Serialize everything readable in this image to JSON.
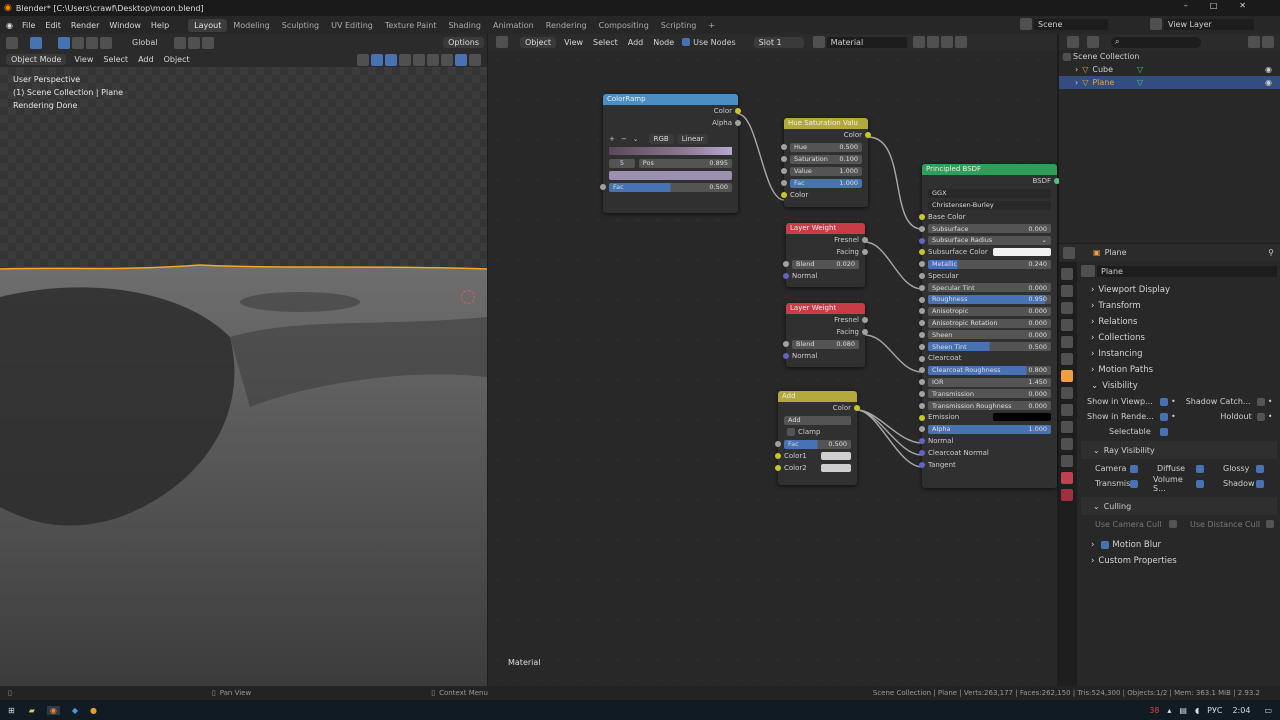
{
  "window": {
    "title": "Blender* [C:\\Users\\crawf\\Desktop\\moon.blend]"
  },
  "menubar": {
    "menus": [
      "File",
      "Edit",
      "Render",
      "Window",
      "Help"
    ],
    "workspaces": [
      "Layout",
      "Modeling",
      "Sculpting",
      "UV Editing",
      "Texture Paint",
      "Shading",
      "Animation",
      "Rendering",
      "Compositing",
      "Scripting"
    ],
    "add_tab": "+",
    "scene": "Scene",
    "view_layer": "View Layer"
  },
  "viewport_header": {
    "orientation": "Global",
    "options": "Options",
    "mode": "Object Mode",
    "menus": [
      "View",
      "Select",
      "Add",
      "Object"
    ]
  },
  "viewport": {
    "info_line1": "User Perspective",
    "info_line2": "(1) Scene Collection | Plane",
    "info_line3": "Rendering Done"
  },
  "node_header": {
    "object_type": "Object",
    "menus": [
      "View",
      "Select",
      "Add",
      "Node"
    ],
    "use_nodes_label": "Use Nodes",
    "slot": "Slot 1",
    "material": "Material",
    "footer_label": "Material"
  },
  "nodes": {
    "colorramp": {
      "title": "ColorRamp",
      "out_color": "Color",
      "out_alpha": "Alpha",
      "mode": "RGB",
      "interp": "Linear",
      "stop_index": "5",
      "pos_label": "Pos",
      "pos_value": "0.895",
      "fac_label": "Fac",
      "fac_value": "0.500",
      "fac_fraction": 0.5
    },
    "hsv": {
      "title": "Hue Saturation Valu",
      "out_color": "Color",
      "hue_label": "Hue",
      "hue_value": "0.500",
      "sat_label": "Saturation",
      "sat_value": "0.100",
      "val_label": "Value",
      "val_value": "1.000",
      "fac_label": "Fac",
      "fac_value": "1.000",
      "fac_fraction": 1.0,
      "in_color": "Color"
    },
    "layerweight1": {
      "title": "Layer Weight",
      "out_fresnel": "Fresnel",
      "out_facing": "Facing",
      "blend_label": "Blend",
      "blend_value": "0.020",
      "in_normal": "Normal"
    },
    "layerweight2": {
      "title": "Layer Weight",
      "out_fresnel": "Fresnel",
      "out_facing": "Facing",
      "blend_label": "Blend",
      "blend_value": "0.080",
      "in_normal": "Normal"
    },
    "add": {
      "title": "Add",
      "out_color": "Color",
      "blend_mode": "Add",
      "clamp_label": "Clamp",
      "fac_label": "Fac",
      "fac_value": "0.500",
      "fac_fraction": 0.5,
      "color1_label": "Color1",
      "color2_label": "Color2"
    },
    "bsdf": {
      "title": "Principled BSDF",
      "out_label": "BSDF",
      "distribution": "GGX",
      "subsurface_method": "Christensen-Burley",
      "rows": [
        {
          "label": "Base Color",
          "value": "",
          "type": "socket"
        },
        {
          "label": "Subsurface",
          "value": "0.000",
          "type": "field",
          "fill": 0
        },
        {
          "label": "Subsurface Radius",
          "value": "",
          "type": "dropdown"
        },
        {
          "label": "Subsurface Color",
          "value": "",
          "type": "color"
        },
        {
          "label": "Metallic",
          "value": "0.240",
          "type": "field",
          "fill": 0.24
        },
        {
          "label": "Specular",
          "value": "",
          "type": "socket"
        },
        {
          "label": "Specular Tint",
          "value": "0.000",
          "type": "field",
          "fill": 0
        },
        {
          "label": "Roughness",
          "value": "0.950",
          "type": "field",
          "fill": 0.95
        },
        {
          "label": "Anisotropic",
          "value": "0.000",
          "type": "field",
          "fill": 0
        },
        {
          "label": "Anisotropic Rotation",
          "value": "0.000",
          "type": "field",
          "fill": 0
        },
        {
          "label": "Sheen",
          "value": "0.000",
          "type": "field",
          "fill": 0
        },
        {
          "label": "Sheen Tint",
          "value": "0.500",
          "type": "field",
          "fill": 0.5
        },
        {
          "label": "Clearcoat",
          "value": "",
          "type": "socket"
        },
        {
          "label": "Clearcoat Roughness",
          "value": "0.800",
          "type": "field",
          "fill": 0.8
        },
        {
          "label": "IOR",
          "value": "1.450",
          "type": "field",
          "fill": 0
        },
        {
          "label": "Transmission",
          "value": "0.000",
          "type": "field",
          "fill": 0
        },
        {
          "label": "Transmission Roughness",
          "value": "0.000",
          "type": "field",
          "fill": 0
        },
        {
          "label": "Emission",
          "value": "",
          "type": "blackcolor"
        },
        {
          "label": "Alpha",
          "value": "1.000",
          "type": "field",
          "fill": 1
        },
        {
          "label": "Normal",
          "value": "",
          "type": "socket"
        },
        {
          "label": "Clearcoat Normal",
          "value": "",
          "type": "socket"
        },
        {
          "label": "Tangent",
          "value": "",
          "type": "socket"
        }
      ]
    }
  },
  "outliner": {
    "root": "Scene Collection",
    "items": [
      "Cube",
      "Plane"
    ]
  },
  "properties": {
    "object_name": "Plane",
    "data_name": "Plane",
    "sections": [
      "Viewport Display",
      "Transform",
      "Relations",
      "Collections",
      "Instancing",
      "Motion Paths"
    ],
    "visibility": {
      "title": "Visibility",
      "show_viewport": "Show in Viewp...",
      "shadow_catcher": "Shadow Catch...",
      "show_render": "Show in Rende...",
      "holdout": "Holdout",
      "selectable": "Selectable",
      "ray_title": "Ray Visibility",
      "camera": "Camera",
      "diffuse": "Diffuse",
      "glossy": "Glossy",
      "transmission": "Transmis...",
      "volume": "Volume S...",
      "shadow": "Shadow",
      "culling_title": "Culling",
      "camera_cull": "Use Camera Cull",
      "distance_cull": "Use Distance Cull"
    },
    "motion_blur": "Motion Blur",
    "custom_props": "Custom Properties"
  },
  "statusbar": {
    "pan": "Pan View",
    "context": "Context Menu",
    "stats": "Scene Collection | Plane | Verts:263,177 | Faces:262,150 | Tris:524,300 | Objects:1/2 | Mem: 363.1 MiB | 2.93.2"
  },
  "taskbar": {
    "lang": "РУС",
    "time": "2:04",
    "badge": "38"
  },
  "colors": {
    "accent": "#4772b3",
    "selection_orange": "#f5a623",
    "node_input": "#4b8ec4",
    "node_color": "#b3a83a",
    "node_shader": "#2f9e5b",
    "node_layer": "#c83b47"
  }
}
